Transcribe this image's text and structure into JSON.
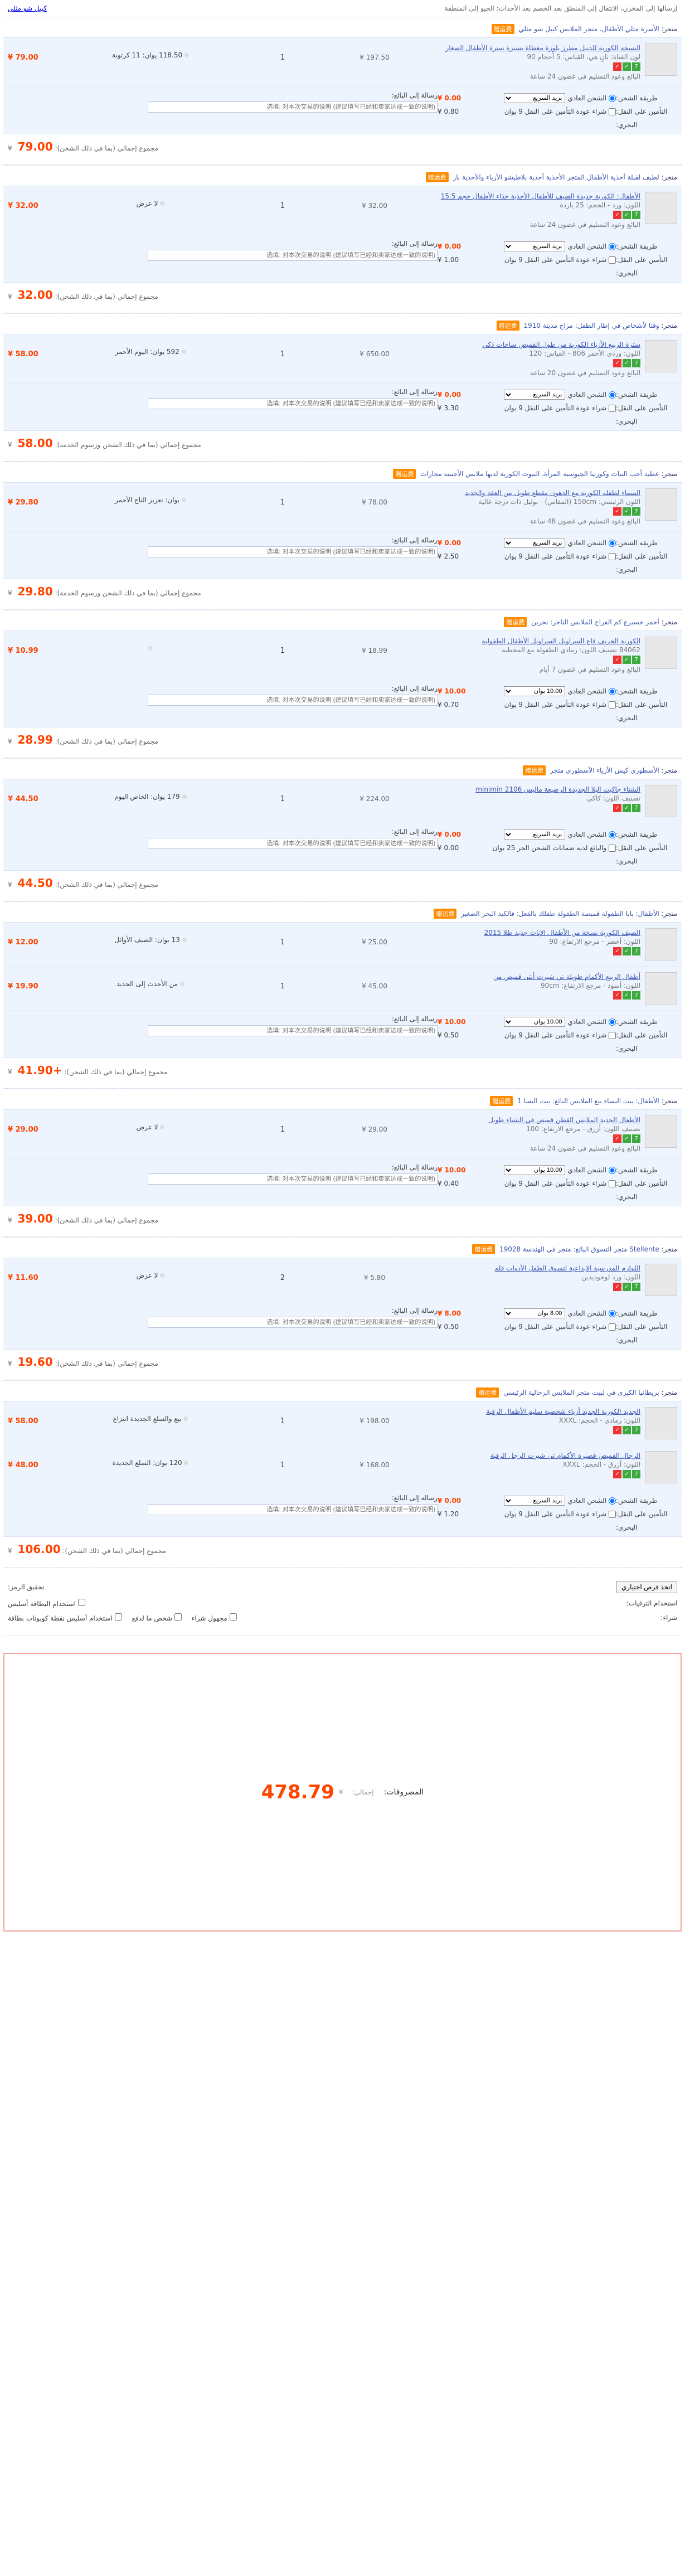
{
  "top": {
    "notice": "إرسالها إلى المخزن، الانتقال إلى المنطق بعد الخصم بعد الأحداث: الجيو إلى المنطقة",
    "link": "كيبل شو مثلي"
  },
  "orders": [
    {
      "shop_label": "متجر:",
      "shop_name": "الأسرة مثلي الأطفال، متجر الملابس كيبل شو مثلي",
      "gift_text": "赠运费",
      "items": [
        {
          "title": "النسخة الكورية للدنيل مطرز بلوزة مغطاة بسترة سترة الأطفال الصغار",
          "spec": "لون الفتاة: ثانٍ هي، القياس: 5 أحجام 90",
          "ship": "البائع وعود التسليم في غضون 24 ساعة",
          "price": "197.50 ¥",
          "qty": "1",
          "promo": "118.50 يوان: 11 كرتونة",
          "subtotal": "79.00 ¥"
        }
      ],
      "shipping_method": "بريد السريع",
      "shipping_choice": "الشحن العادي",
      "shipping_amt": "0.00 ¥",
      "insurance_opt": "شراء عودة التأمين على النقل 9 يوان",
      "insurance_amt": "0.80 ¥",
      "total_label": "مجموع إجمالي (بما في ذلك الشحن):",
      "total": "79.00"
    },
    {
      "shop_label": "متجر:",
      "shop_name": "لطيف لقبلة أحذية الأطفال المتجر الأحذية أحذية بلاطيشو الأزياء والأحذية بار",
      "gift_text": "赠运费",
      "items": [
        {
          "title": "الأطفال: الكورية جديدة الصيف للأطفال الأحذية حذاء الأطفال حجم 15.5",
          "spec": "اللون: ورد - الحجم: 25 ياردة",
          "ship": "البائع وعود التسليم في غضون 24 ساعة",
          "price": "32.00 ¥",
          "qty": "1",
          "promo": "لا عرض",
          "subtotal": "32.00 ¥"
        }
      ],
      "shipping_method": "بريد السريع",
      "shipping_choice": "الشحن العادي",
      "shipping_amt": "0.00 ¥",
      "insurance_opt": "شراء عودة التأمين على النقل 9 يوان",
      "insurance_amt": "1.00 ¥",
      "total_label": "مجموع إجمالي (بما في ذلك الشحن):",
      "total": "32.00"
    },
    {
      "shop_label": "متجر:",
      "shop_name": "وقتا لأشخاص في إطار الطفل: مزاج مدينة 1910",
      "gift_text": "赠运费",
      "items": [
        {
          "title": "سترة الربيع الأزياء الكورية من طول القميص ساحات ذكي",
          "spec": "اللون: وردي الأحمر 806 - القياس: 120",
          "ship": "البائع وعود التسليم في غضون 20 ساعة",
          "price": "650.00 ¥",
          "qty": "1",
          "promo": "592 يوان: اليوم الأحمر",
          "subtotal": "58.00 ¥"
        }
      ],
      "shipping_method": "بريد السريع",
      "shipping_choice": "الشحن العادي",
      "shipping_amt": "0.00 ¥",
      "insurance_opt": "شراء عودة التأمين على النقل 9 يوان",
      "insurance_amt": "3.30 ¥",
      "total_label": "مجموع إجمالي (بما في ذلك الشحن ورسوم الخدمة):",
      "total": "58.00"
    },
    {
      "shop_label": "متجر:",
      "shop_name": "عطيد أحب البنات وكورتيا الجيوسية المرأة، البيوت الكورية لديها ملابس الأجنبية مجارات",
      "gift_text": "赠运费",
      "items": [
        {
          "title": "السماء لطفلة الكورية مع الدهون مقطع طويل من العقد والجديد",
          "spec": "اللون الرئيسي: 150cm (المقاس) - بوليل ذات درجة عالية",
          "ship": "البائع وعود التسليم في غضون 48 ساعة",
          "price": "78.00 ¥",
          "qty": "1",
          "promo": "يوان: تعزيز التاج الأحمر",
          "subtotal": "29.80 ¥"
        }
      ],
      "shipping_method": "بريد السريع",
      "shipping_choice": "الشحن العادي",
      "shipping_amt": "0.00 ¥",
      "insurance_opt": "شراء عودة التأمين على النقل 9 يوان",
      "insurance_amt": "2.50 ¥",
      "total_label": "مجموع إجمالي (بما في ذلك الشحن ورسوم الخدمة):",
      "total": "29.80"
    },
    {
      "shop_label": "متجر:",
      "shop_name": "أحمر جسيرع كم الفراج الملابس التاجر: نحرين",
      "gift_text": "赠运费",
      "items": [
        {
          "title": "الكورية الخريف قاع السراويل السراويل الأطفال الطفولية",
          "spec": "84062 تصنيف اللون: رمادي الطفولة مع المحطية",
          "ship": "البائع وعود التسليم في غضون 7 أيام",
          "price": "18.99 ¥",
          "qty": "1",
          "promo": "",
          "subtotal": "10.99 ¥"
        }
      ],
      "shipping_method": "10.00 يوان",
      "shipping_choice": "الشحن العادي",
      "shipping_amt": "10.00 ¥",
      "insurance_opt": "شراء عودة التأمين على النقل 9 يوان",
      "insurance_amt": "0.70 ¥",
      "total_label": "مجموع إجمالي (بما في ذلك الشحن):",
      "total": "28.99"
    },
    {
      "shop_label": "متجر:",
      "shop_name": "الأسطوري كيس الأزياء الأسطوري متجر",
      "gift_text": "赠运费",
      "items": [
        {
          "title": "الشتاء جاكيت البلا الجديدة الرضيعة ماليس 2106 minimin",
          "spec": "تصنيف اللون: كاكي",
          "ship": "",
          "price": "224.00 ¥",
          "qty": "1",
          "promo": "179 يوان: الخاص اليوم",
          "subtotal": "44.50 ¥"
        }
      ],
      "shipping_method": "بريد السريع",
      "shipping_choice": "الشحن العادي",
      "shipping_amt": "0.00 ¥",
      "insurance_opt": "والبائع لديه ضمانات الشحن الحر 25 يوان",
      "insurance_amt": "0.00 ¥",
      "total_label": "مجموع إجمالي (بما في ذلك الشحن):",
      "total": "44.50"
    },
    {
      "shop_label": "متجر:",
      "shop_name": "الأطفال: بابا الطفولة قميصة الطفولة طفلك بالفعل: فالكيد البحر الصغير",
      "gift_text": "赠运费",
      "items": [
        {
          "title": "الصيف الكورية نسخة من الأطفال الإناث جديد طلا 2015",
          "spec": "اللون: أخضر - مرجع الارتفاع: 90",
          "ship": "",
          "price": "25.00 ¥",
          "qty": "1",
          "promo": "13 يوان: الصيف الأوائل",
          "subtotal": "12.00 ¥"
        },
        {
          "title": "أطفال الربيع الأكمام طويلة تي شيرت أنثى قميص من",
          "spec": "اللون: أسود - مرجع الارتفاع: 90cm",
          "ship": "",
          "price": "45.00 ¥",
          "qty": "1",
          "promo": "من الأحدث إلى الجديد",
          "subtotal": "19.90 ¥"
        }
      ],
      "shipping_method": "10.00 يوان",
      "shipping_choice": "الشحن العادي",
      "shipping_amt": "10.00 ¥",
      "insurance_opt": "شراء عودة التأمين على النقل 9 يوان",
      "insurance_amt": "0.50 ¥",
      "total_label": "مجموع إجمالي (بما في ذلك الشحن):",
      "total": "+41.90"
    },
    {
      "shop_label": "متجر:",
      "shop_name": "الأطفال: بيت النساء بيع الملابس البائع: بيت اليسا 1",
      "gift_text": "赠运费",
      "items": [
        {
          "title": "الأطفال الجديد الملابس القطن قميص في الشتاء طويل",
          "spec": "تصنيف اللون: أزرق - مرجع الارتفاع: 100",
          "ship": "البائع وعود التسليم في غضون 24 ساعة",
          "price": "29.00 ¥",
          "qty": "1",
          "promo": "لا عرض",
          "subtotal": "29.00 ¥"
        }
      ],
      "shipping_method": "10.00 يوان",
      "shipping_choice": "الشحن العادي",
      "shipping_amt": "10.00 ¥",
      "insurance_opt": "شراء عودة التأمين على النقل 9 يوان",
      "insurance_amt": "0.40 ¥",
      "total_label": "مجموع إجمالي (بما في ذلك الشحن):",
      "total": "39.00"
    },
    {
      "shop_label": "متجر:",
      "shop_name": "Stellente متجر التسوق البائع: متجر في الهندسة 19028",
      "gift_text": "赠运费",
      "items": [
        {
          "title": "اللوازم المدرسية الإبداعية لتسوق الطفل الأدوات قلم",
          "spec": "اللون: ورد لوجوديدين",
          "ship": "",
          "price": "5.80 ¥",
          "qty": "2",
          "promo": "لا عرض",
          "subtotal": "11.60 ¥"
        }
      ],
      "shipping_method": "8.00 يوان",
      "shipping_choice": "الشحن العادي",
      "shipping_amt": "8.00 ¥",
      "insurance_opt": "شراء عودة التأمين على النقل 9 يوان",
      "insurance_amt": "0.50 ¥",
      "total_label": "مجموع إجمالي (بما في ذلك الشحن):",
      "total": "19.60"
    },
    {
      "shop_label": "متجر:",
      "shop_name": "بريطانيا الكبرى في لبيت متجر الملابس الرحالية الرئيسي",
      "gift_text": "赠运费",
      "items": [
        {
          "title": "الجديد الكورية الجديد أزياء شخصية سليم الأطفال الرقبة",
          "spec": "اللون: رمادي - الحجم: XXXL",
          "ship": "",
          "price": "198.00 ¥",
          "qty": "1",
          "promo": "بيع والسلع الجديدة انتزاع",
          "subtotal": "58.00 ¥"
        },
        {
          "title": "الرجال القميص قصيرة الأكمام تي شيرت الرجل الرقبة",
          "spec": "اللون: أزرق - الحجم: XXXL",
          "ship": "",
          "price": "168.00 ¥",
          "qty": "1",
          "promo": "120 يوان: السلع الجديدة",
          "subtotal": "48.00 ¥"
        }
      ],
      "shipping_method": "بريد السريع",
      "shipping_choice": "الشحن العادي",
      "shipping_amt": "0.00 ¥",
      "insurance_opt": "شراء عودة التأمين على النقل 9 يوان",
      "insurance_amt": "1.20 ¥",
      "total_label": "مجموع إجمالي (بما في ذلك الشحن):",
      "total": "106.00"
    }
  ],
  "labels": {
    "message": "رسالة إلى البائع:",
    "message_placeholder": "选填: 对本次交易的说明 (建议填写已经和卖家达成一致的说明)",
    "ship_method": "طريقة الشحن:",
    "ship_insurance": "التأمين على النقل:",
    "ship_sea": "البحري:"
  },
  "footer": {
    "coupon_btn": "اتخذ فرص اختياري",
    "coupon_label": "تحقيق الرمز:",
    "point_label": "استخدام البطاقة أسليس",
    "point_hint": "استخدام الترقيات:",
    "anon_label": "مجهول شراء",
    "anon2_label": "شخص ما لدفع",
    "tick_label": "استخدام أسليس نقطة كوبونات بطاقة",
    "buy_label": "شراء:"
  },
  "summary": {
    "label": "المصروفات:",
    "amount": "478.79",
    "currency": "¥",
    "small1": "إجمالي:",
    "small2": "الشحن"
  }
}
